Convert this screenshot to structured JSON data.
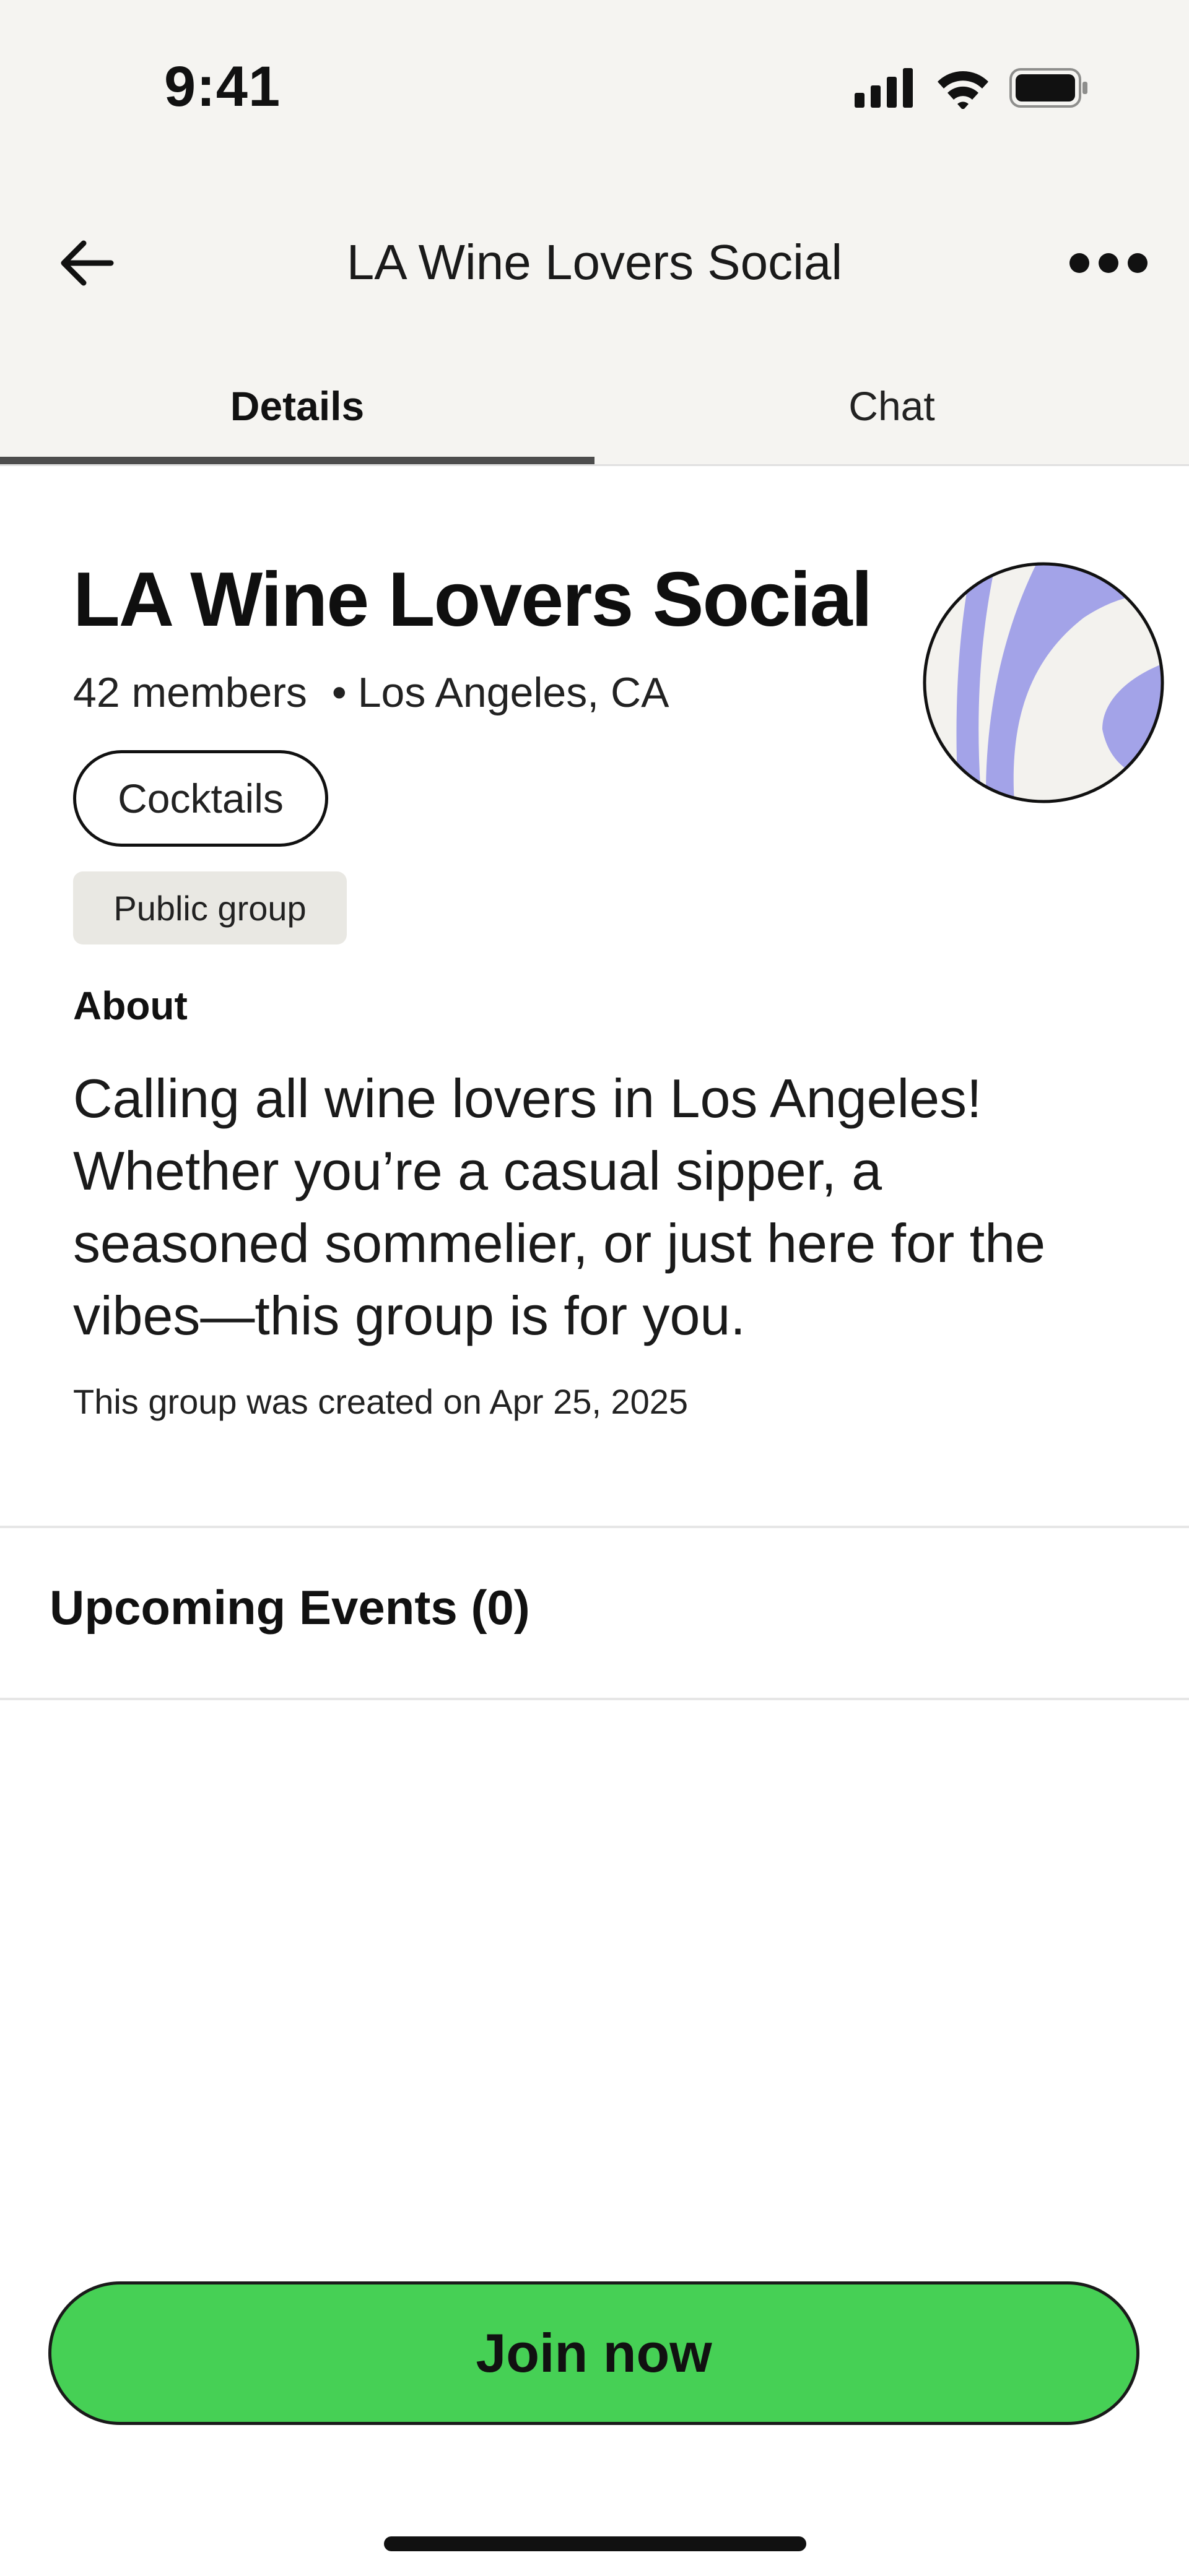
{
  "status_bar": {
    "time": "9:41"
  },
  "header": {
    "title": "LA Wine Lovers Social"
  },
  "tabs": [
    {
      "label": "Details",
      "active": true
    },
    {
      "label": "Chat",
      "active": false
    }
  ],
  "group": {
    "name": "LA Wine Lovers Social",
    "members": "42 members",
    "location": "Los Angeles, CA",
    "topic_chip": "Cocktails",
    "visibility_badge": "Public group"
  },
  "about": {
    "heading": "About",
    "body": "Calling all wine lovers in Los Angeles! Whether you’re a casual sipper, a seasoned sommelier, or just here for the vibes—this group is for you.",
    "created": "This group was created on Apr 25, 2025"
  },
  "events": {
    "heading": "Upcoming Events (0)"
  },
  "actions": {
    "join_label": "Join now"
  },
  "colors": {
    "header_bg": "#f5f4f1",
    "join_button": "#46d055",
    "avatar_bg": "#f3f2ee",
    "avatar_accent": "#a3a3e8",
    "tab_indicator": "#4d4d4d"
  }
}
